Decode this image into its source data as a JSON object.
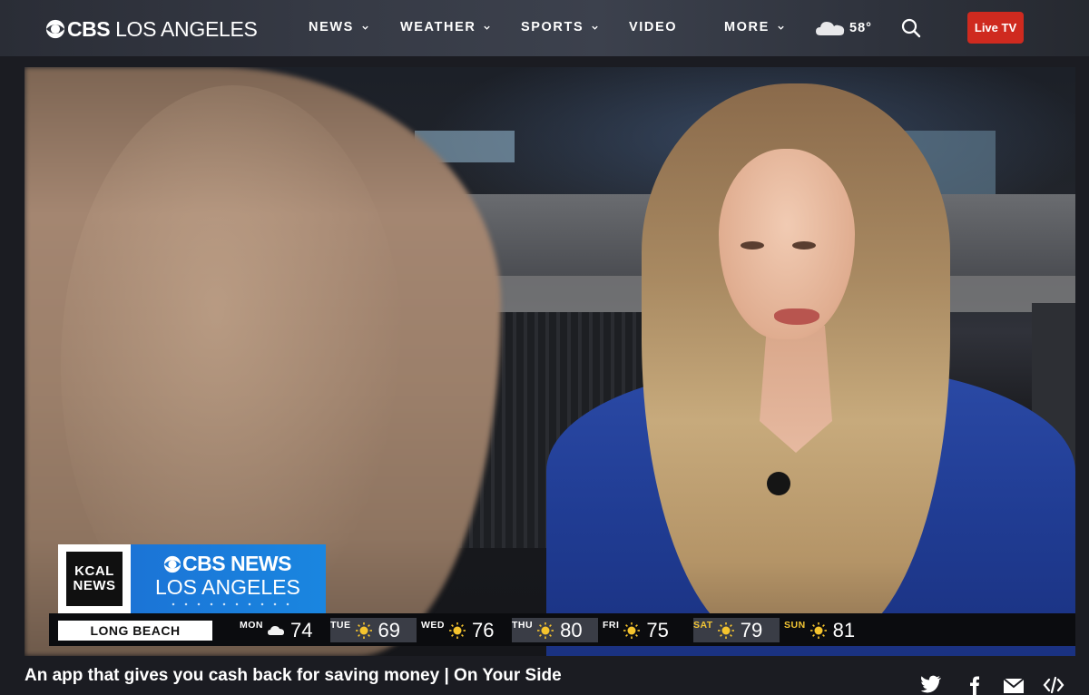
{
  "header": {
    "logo_brand": "CBS",
    "logo_city": "LOS ANGELES",
    "nav": [
      {
        "label": "NEWS",
        "has_dropdown": true
      },
      {
        "label": "WEATHER",
        "has_dropdown": true
      },
      {
        "label": "SPORTS",
        "has_dropdown": true
      },
      {
        "label": "VIDEO",
        "has_dropdown": false
      },
      {
        "label": "MORE",
        "has_dropdown": true
      }
    ],
    "weather": {
      "icon": "cloud-icon",
      "temp": "58°"
    },
    "search_icon": "search-icon",
    "live_tv_label": "Live TV",
    "live_tv_color": "#cf2a1f"
  },
  "video": {
    "lower_third": {
      "kcal_line1": "KCAL",
      "kcal_line2": "NEWS",
      "cbs_brand": "CBS NEWS",
      "cbs_city": "LOS ANGELES",
      "accent_color": "#1b74d6"
    },
    "ticker": {
      "location": "LONG BEACH",
      "forecast": [
        {
          "day": "MON",
          "icon": "cloud-icon",
          "temp": "74"
        },
        {
          "day": "TUE",
          "icon": "sun-icon",
          "temp": "69"
        },
        {
          "day": "WED",
          "icon": "sun-icon",
          "temp": "76"
        },
        {
          "day": "THU",
          "icon": "sun-icon",
          "temp": "80"
        },
        {
          "day": "FRI",
          "icon": "sun-icon",
          "temp": "75"
        },
        {
          "day": "SAT",
          "icon": "sun-icon",
          "temp": "79"
        },
        {
          "day": "SUN",
          "icon": "sun-icon",
          "temp": "81"
        }
      ]
    }
  },
  "caption": "An app that gives you cash back for saving money | On Your Side",
  "share": [
    "twitter-icon",
    "facebook-icon",
    "email-icon",
    "embed-icon"
  ]
}
